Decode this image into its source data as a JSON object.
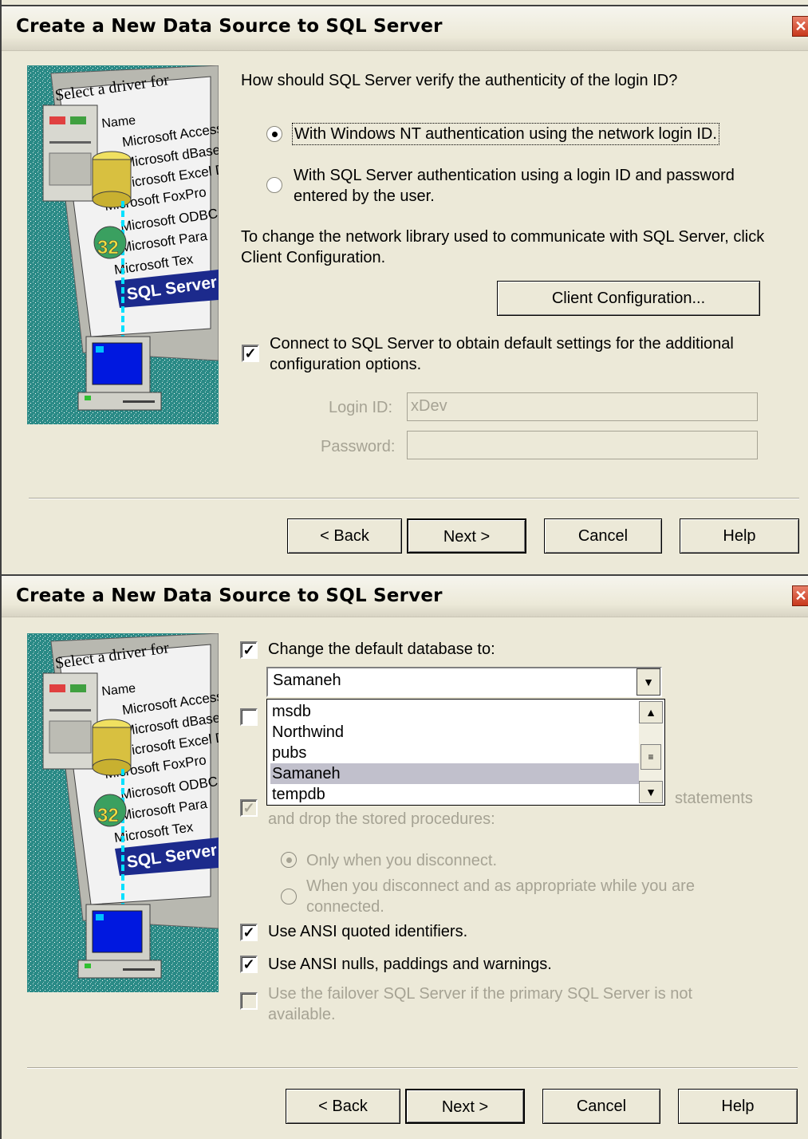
{
  "dialog1": {
    "title": "Create a New Data Source to SQL Server",
    "question": "How should SQL Server verify the authenticity of the login ID?",
    "radio_nt_label": "With Windows NT authentication using the network login ID.",
    "radio_sql_label": "With SQL Server authentication using a login ID and password entered by the user.",
    "network_text": "To change the network library used to communicate with SQL Server, click Client Configuration.",
    "client_config_label": "Client Configuration...",
    "connect_label": "Connect to SQL Server to obtain default settings for the additional configuration options.",
    "login_label": "Login ID:",
    "login_value": "xDev",
    "password_label": "Password:",
    "password_value": "",
    "buttons": {
      "back": "< Back",
      "next": "Next >",
      "cancel": "Cancel",
      "help": "Help"
    }
  },
  "dialog2": {
    "title": "Create a New Data Source to SQL Server",
    "change_db_label": "Change the default database to:",
    "combo_value": "Samaneh",
    "dropdown_items": [
      "msdb",
      "Northwind",
      "pubs",
      "Samaneh",
      "tempdb"
    ],
    "selected_item": "Samaneh",
    "stored_proc_tail": "statements",
    "stored_proc_line2": "and drop the stored procedures:",
    "only_disconnect_label": "Only when you disconnect.",
    "when_disconnect_label": "When you disconnect and as appropriate while you are connected.",
    "ansi_quoted_label": "Use ANSI quoted identifiers.",
    "ansi_nulls_label": "Use ANSI nulls, paddings and warnings.",
    "failover_label": "Use the failover SQL Server if the primary SQL Server is not available.",
    "buttons": {
      "back": "< Back",
      "next": "Next >",
      "cancel": "Cancel",
      "help": "Help"
    }
  },
  "wizard_art": {
    "header": "Select a driver for",
    "column": "Name",
    "drivers": [
      "Microsoft Access D",
      "Microsoft dBase D",
      "Microsoft Excel D",
      "Microsoft FoxPro",
      "Microsoft ODBC",
      "Microsoft Para",
      "Microsoft Tex",
      "SQL Server"
    ],
    "badge": "32"
  },
  "colors": {
    "face": "#ece9d8",
    "teal": "#2a8a86",
    "selection": "#1c2a8c",
    "close": "#c8391c"
  }
}
